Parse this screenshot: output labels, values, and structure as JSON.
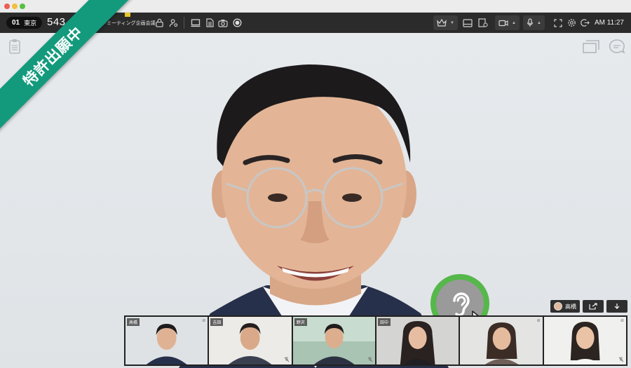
{
  "toolbar": {
    "room_number": "01",
    "room_name": "東京",
    "meeting_id": "543 456",
    "meeting_name": "リモートミーティング企画会議",
    "clock": "AM 11:27"
  },
  "ribbon": {
    "text": "特許出願中"
  },
  "controls": {
    "speaker_name": "高橋"
  },
  "participants": [
    {
      "name": "高橋",
      "active": true
    },
    {
      "name": "吉田",
      "active": false
    },
    {
      "name": "野沢",
      "active": false
    },
    {
      "name": "田中",
      "active": false
    },
    {
      "name": "",
      "active": false
    },
    {
      "name": "",
      "active": false
    }
  ],
  "colors": {
    "accent": "#56b74a",
    "ribbon": "#139a7c",
    "toolbar": "#2b2b2b"
  }
}
